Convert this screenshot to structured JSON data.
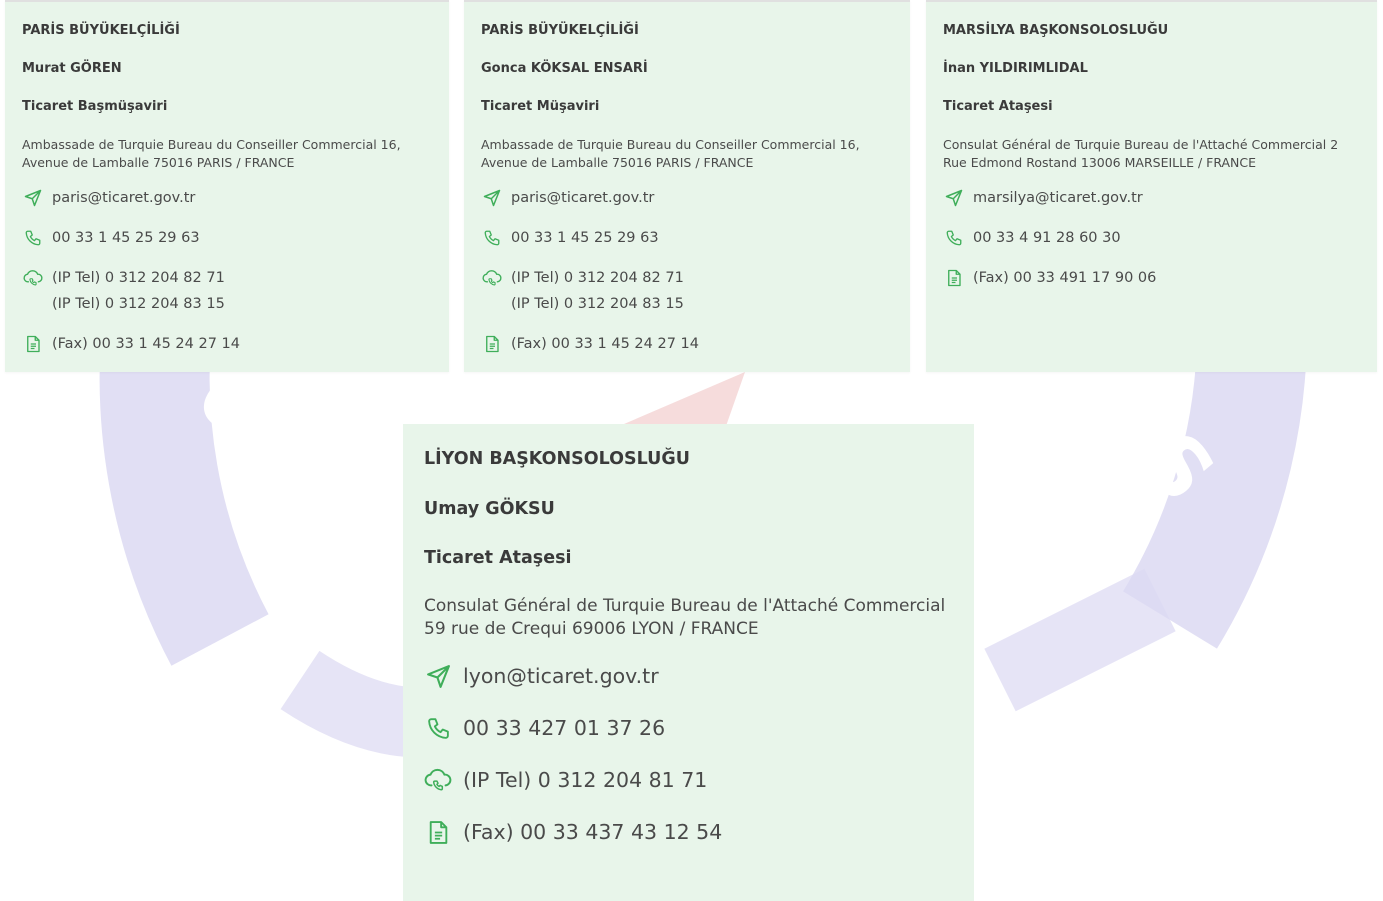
{
  "colors": {
    "card_bg": "#e8f5ea",
    "icon_green": "#3fae5a",
    "text": "#3c3c3c",
    "watermark_purple": "#d9d6f0",
    "watermark_red": "#f6dcdc"
  },
  "offices": [
    {
      "title": "PARİS BÜYÜKELÇİLİĞİ",
      "name": "Murat GÖREN",
      "role": "Ticaret Başmüşaviri",
      "address": "Ambassade de Turquie Bureau du Conseiller Commercial 16, Avenue de Lamballe 75016 PARIS / FRANCE",
      "email": "paris@ticaret.gov.tr",
      "phone": "00 33 1 45 25 29 63",
      "ip_tel_1": "(IP Tel) 0 312 204 82 71",
      "ip_tel_2": "(IP Tel) 0 312 204 83 15",
      "fax": "(Fax) 00 33 1 45 24 27 14"
    },
    {
      "title": "PARİS BÜYÜKELÇİLİĞİ",
      "name": "Gonca KÖKSAL ENSARİ",
      "role": "Ticaret Müşaviri",
      "address": "Ambassade de Turquie Bureau du Conseiller Commercial 16, Avenue de Lamballe 75016 PARIS / FRANCE",
      "email": "paris@ticaret.gov.tr",
      "phone": "00 33 1 45 25 29 63",
      "ip_tel_1": "(IP Tel) 0 312 204 82 71",
      "ip_tel_2": "(IP Tel) 0 312 204 83 15",
      "fax": "(Fax) 00 33 1 45 24 27 14"
    },
    {
      "title": "MARSİLYA BAŞKONSOLOSLUĞU",
      "name": "İnan YILDIRIMLIDAL",
      "role": "Ticaret Ataşesi",
      "address": "Consulat Général de Turquie Bureau de l'Attaché Commercial 2 Rue Edmond Rostand 13006 MARSEILLE / FRANCE",
      "email": "marsilya@ticaret.gov.tr",
      "phone": "00 33 4 91 28 60 30",
      "fax": "(Fax) 00 33 491 17 90 06"
    },
    {
      "title": "LİYON BAŞKONSOLOSLUĞU",
      "name": "Umay GÖKSU",
      "role": "Ticaret Ataşesi",
      "address": "Consulat Général de Turquie Bureau de l'Attaché Commercial 59 rue de Crequi 69006 LYON / FRANCE",
      "email": "lyon@ticaret.gov.tr",
      "phone": "00 33 427 01 37 26",
      "ip_tel_1": "(IP Tel) 0 312 204 81 71",
      "fax": "(Fax) 00 33 437 43 12 54"
    }
  ],
  "icons": {
    "email": "send-icon",
    "phone": "phone-icon",
    "ip_tel": "cloud-phone-icon",
    "fax": "document-icon"
  }
}
